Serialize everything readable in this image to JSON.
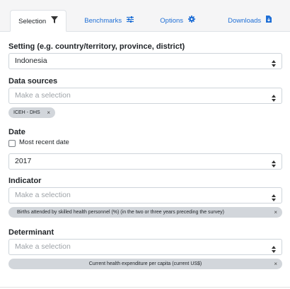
{
  "tabs": {
    "selection": "Selection",
    "benchmarks": "Benchmarks",
    "options": "Options",
    "downloads": "Downloads"
  },
  "setting": {
    "label": "Setting (e.g. country/territory, province, district)",
    "value": "Indonesia"
  },
  "data_sources": {
    "label": "Data sources",
    "placeholder": "Make a selection",
    "chips": [
      "ICEH - DHS"
    ]
  },
  "date": {
    "label": "Date",
    "checkbox_label": "Most recent date",
    "checkbox_checked": false,
    "value": "2017"
  },
  "indicator": {
    "label": "Indicator",
    "placeholder": "Make a selection",
    "chip": "Births attended by skilled health personnel (%) (in the two or three years preceding the survey)"
  },
  "determinant": {
    "label": "Determinant",
    "placeholder": "Make a selection",
    "chip": "Current health expenditure per capita (current US$)"
  },
  "icons": {
    "selection": "filter-icon",
    "benchmarks": "sliders-icon",
    "options": "gear-icon",
    "downloads": "file-download-icon",
    "select_caret": "sort-caret-icon",
    "chip_remove": "close-icon"
  },
  "colors": {
    "accent": "#1f6fd6",
    "chip_bg": "#d2d6db",
    "border": "#ced4da"
  },
  "remove_glyph": "×"
}
